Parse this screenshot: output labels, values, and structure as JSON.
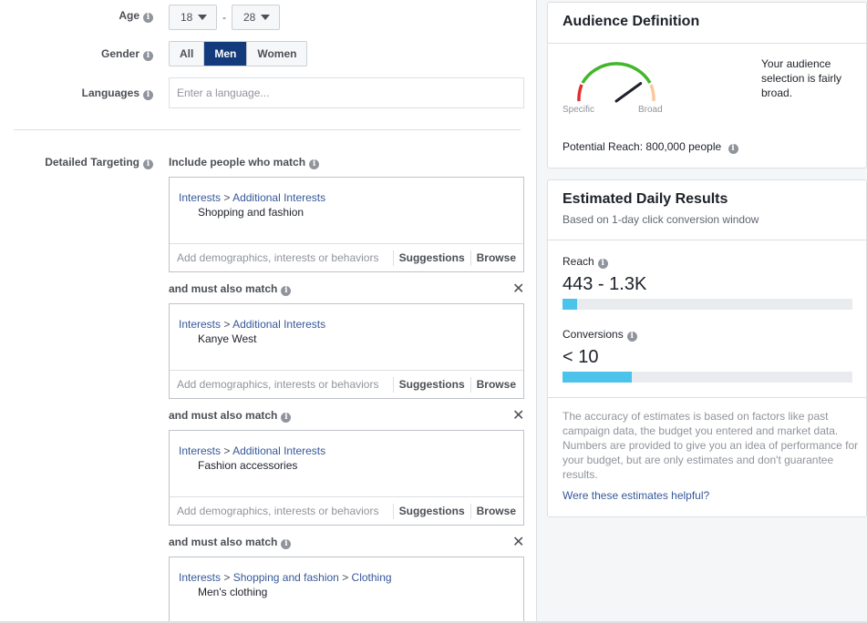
{
  "form": {
    "age_label": "Age",
    "age_min": "18",
    "age_max": "28",
    "age_separator": "-",
    "gender_label": "Gender",
    "gender_options": [
      "All",
      "Men",
      "Women"
    ],
    "gender_selected": "Men",
    "languages_label": "Languages",
    "languages_placeholder": "Enter a language...",
    "detailed_targeting_label": "Detailed Targeting",
    "include_label": "Include people who match",
    "must_also_match_label": "and must also match",
    "add_placeholder": "Add demographics, interests or behaviors",
    "suggestions_label": "Suggestions",
    "browse_label": "Browse",
    "close_symbol": "✕",
    "breadcrumb_separator": ">",
    "groups": [
      {
        "path": [
          "Interests",
          "Additional Interests"
        ],
        "item": "Shopping and fashion"
      },
      {
        "path": [
          "Interests",
          "Additional Interests"
        ],
        "item": "Kanye West"
      },
      {
        "path": [
          "Interests",
          "Additional Interests"
        ],
        "item": "Fashion accessories"
      },
      {
        "path": [
          "Interests",
          "Shopping and fashion",
          "Clothing"
        ],
        "item": "Men's clothing"
      }
    ],
    "info_glyph": "i"
  },
  "audience": {
    "title": "Audience Definition",
    "gauge_specific": "Specific",
    "gauge_broad": "Broad",
    "gauge_level": 0.8,
    "description": "Your audience selection is fairly broad.",
    "reach_label": "Potential Reach:",
    "reach_value": "800,000 people"
  },
  "estimates": {
    "title": "Estimated Daily Results",
    "subtitle": "Based on 1-day click conversion window",
    "reach_label": "Reach",
    "reach_value": "443 - 1.3K",
    "reach_fill": 0.05,
    "conversions_label": "Conversions",
    "conversions_value": "< 10",
    "conversions_fill": 0.24,
    "disclaimer": "The accuracy of estimates is based on factors like past campaign data, the budget you entered and market data. Numbers are provided to give you an idea of performance for your budget, but are only estimates and don't guarantee results.",
    "helpful_link": "Were these estimates helpful?"
  },
  "colors": {
    "selected_gender": "#133a7c",
    "link": "#365899",
    "bar_fill": "#4cc3ea",
    "gauge_green": "#42b72a",
    "gauge_red": "#e02f2f"
  }
}
